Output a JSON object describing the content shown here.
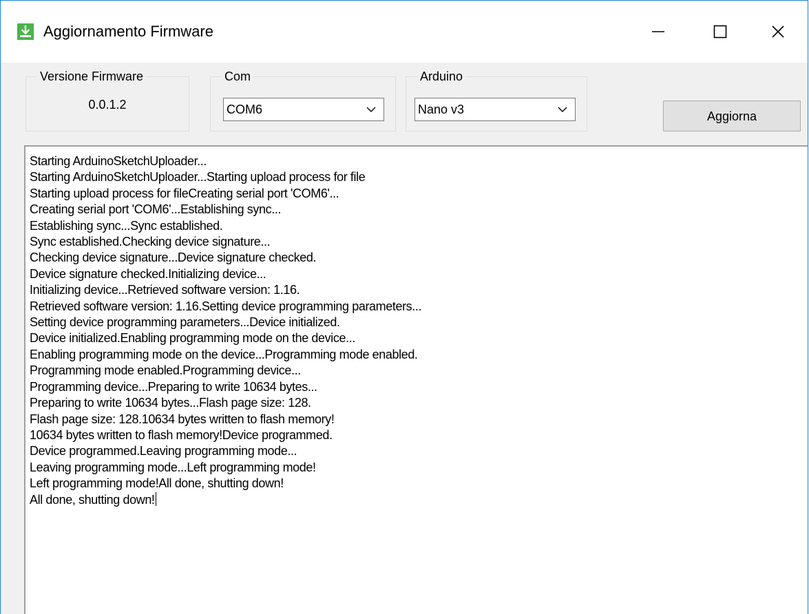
{
  "window": {
    "title": "Aggiornamento Firmware",
    "icon": "download-arrow-icon"
  },
  "groups": {
    "version": {
      "label": "Versione Firmware",
      "value": "0.0.1.2"
    },
    "com": {
      "label": "Com",
      "selected": "COM6"
    },
    "arduino": {
      "label": "Arduino",
      "selected": "Nano v3"
    }
  },
  "actions": {
    "update_label": "Aggiorna"
  },
  "log": {
    "lines": [
      "Starting ArduinoSketchUploader...",
      "Starting ArduinoSketchUploader...Starting upload process for file",
      "Starting upload process for fileCreating serial port 'COM6'...",
      "Creating serial port 'COM6'...Establishing sync...",
      "Establishing sync...Sync established.",
      "Sync established.Checking device signature...",
      "Checking device signature...Device signature checked.",
      "Device signature checked.Initializing device...",
      "Initializing device...Retrieved software version: 1.16.",
      "Retrieved software version: 1.16.Setting device programming parameters...",
      "Setting device programming parameters...Device initialized.",
      "Device initialized.Enabling programming mode on the device...",
      "Enabling programming mode on the device...Programming mode enabled.",
      "Programming mode enabled.Programming device...",
      "Programming device...Preparing to write 10634 bytes...",
      "Preparing to write 10634 bytes...Flash page size: 128.",
      "Flash page size: 128.10634 bytes written to flash memory!",
      "10634 bytes written to flash memory!Device programmed.",
      "Device programmed.Leaving programming mode...",
      "Leaving programming mode...Left programming mode!",
      "Left programming mode!All done, shutting down!",
      "All done, shutting down!"
    ]
  },
  "colors": {
    "window_border": "#1883d7",
    "icon_green": "#4bb34b",
    "button_face": "#e1e1e1"
  }
}
